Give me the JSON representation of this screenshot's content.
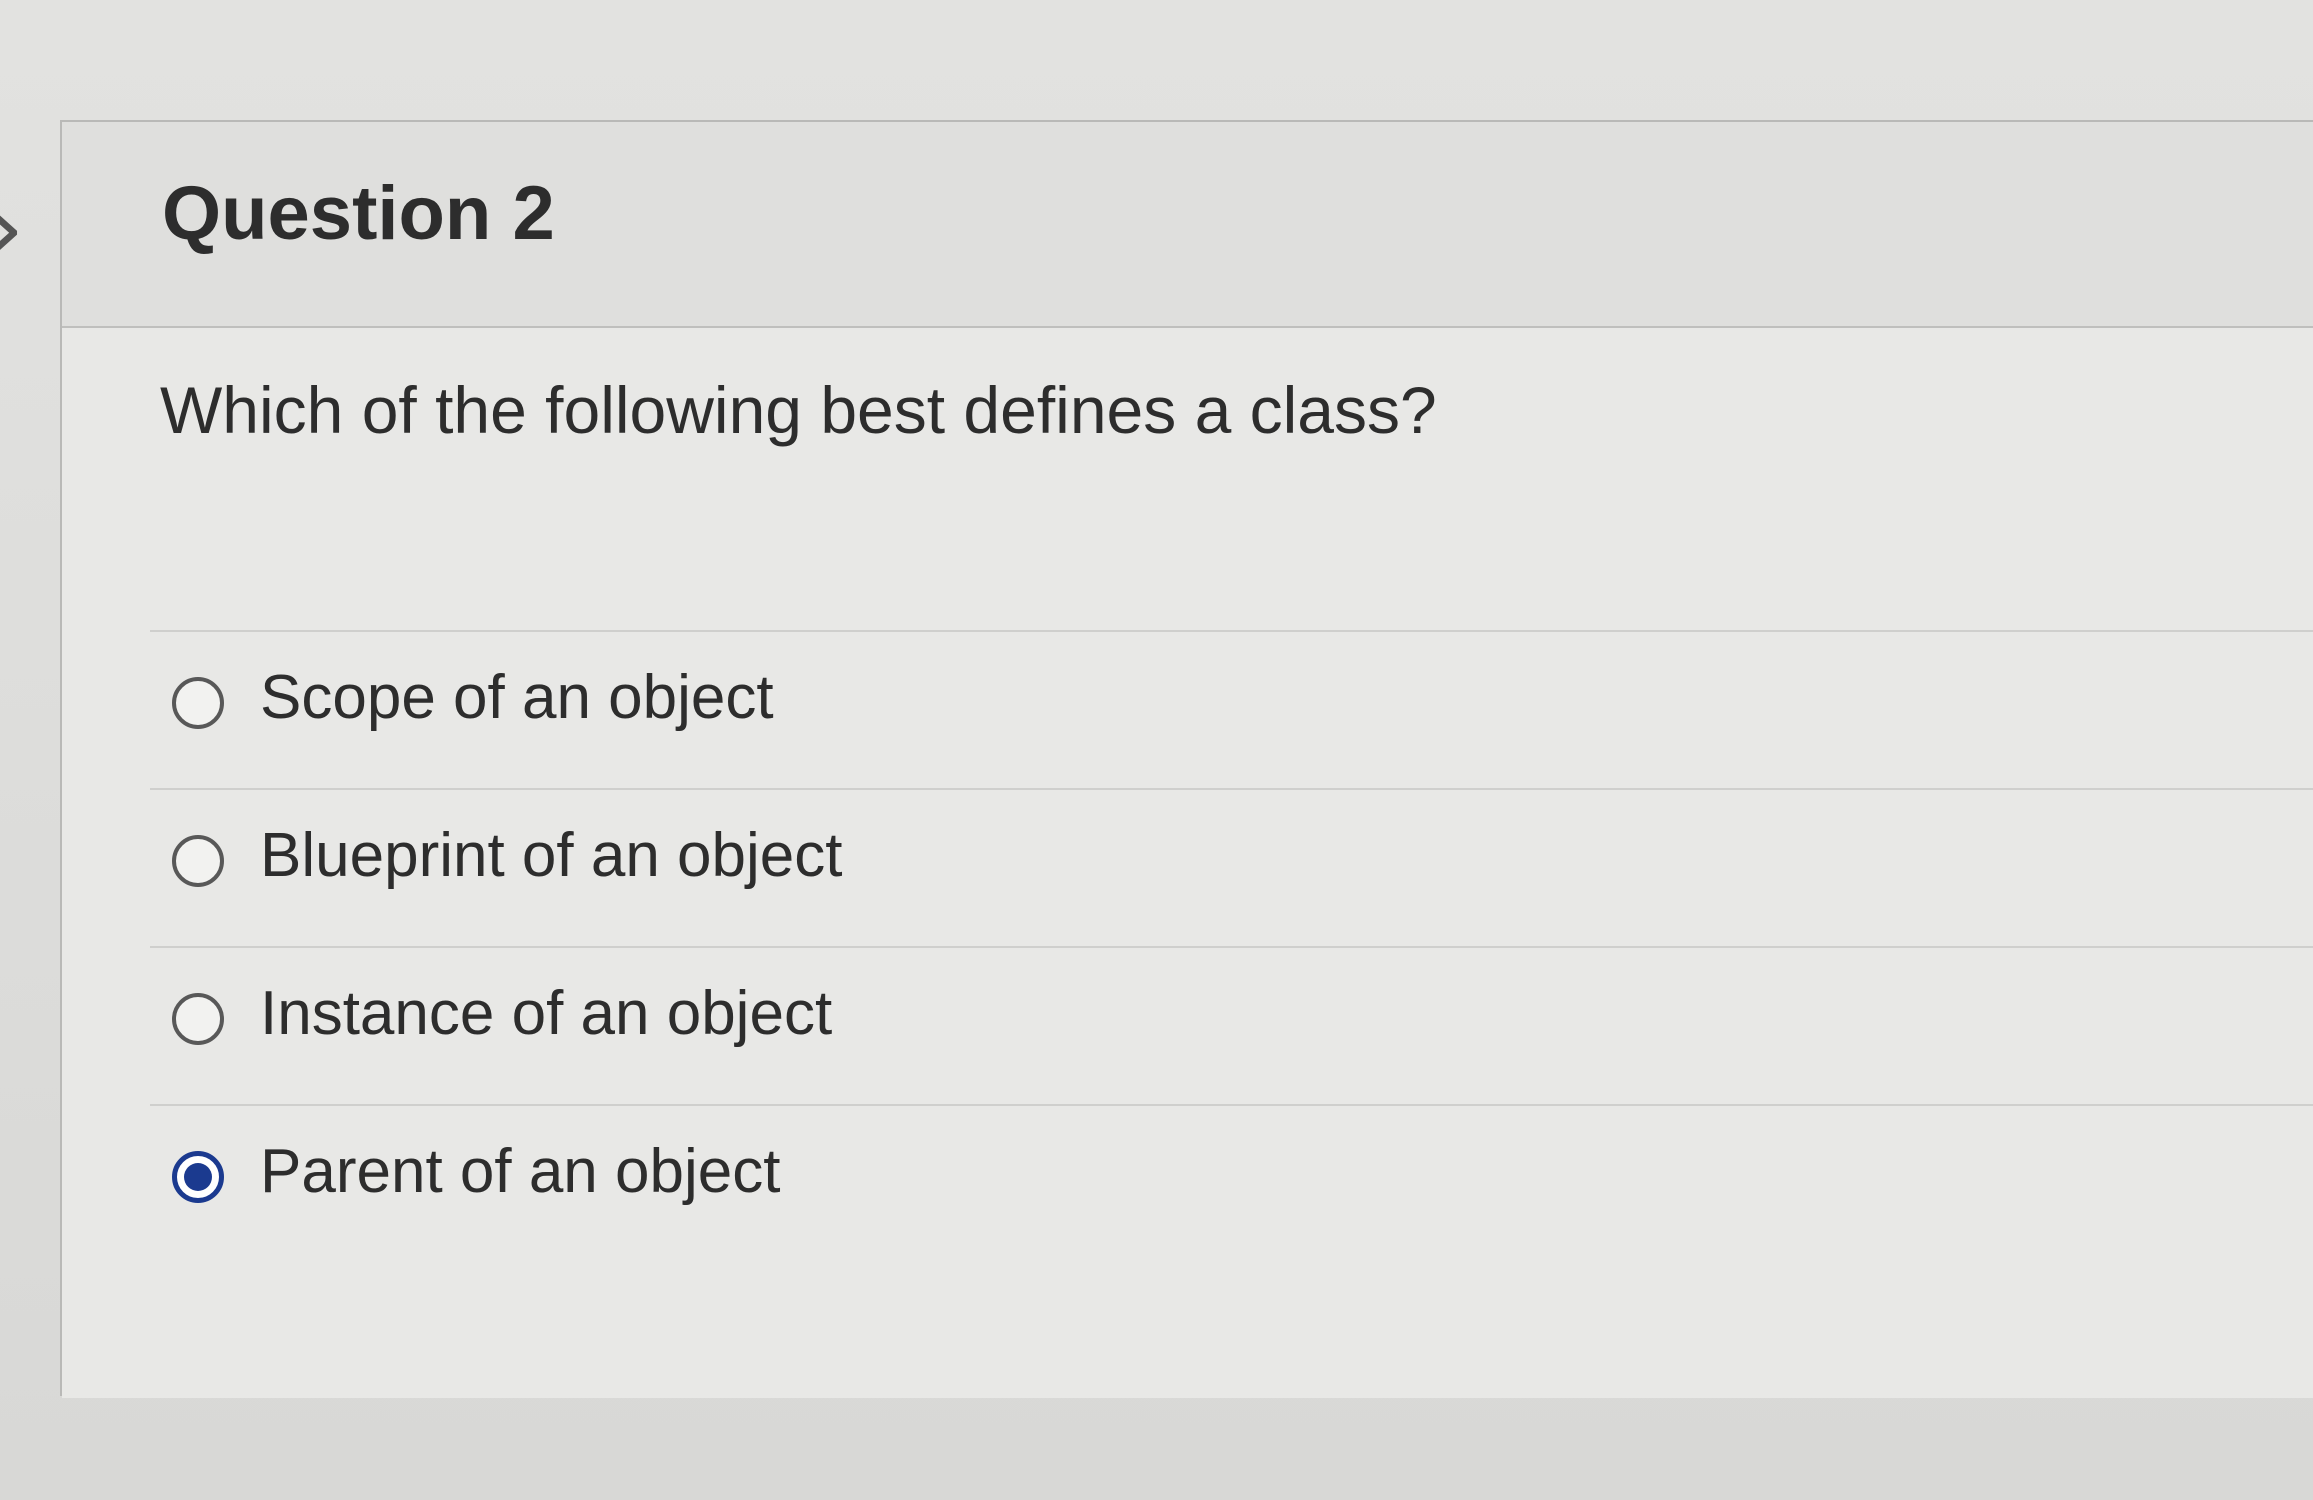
{
  "question": {
    "title": "Question 2",
    "prompt": "Which of the following best defines a class?",
    "options": [
      {
        "label": "Scope of an object",
        "selected": false
      },
      {
        "label": "Blueprint of an object",
        "selected": false
      },
      {
        "label": "Instance of an object",
        "selected": false
      },
      {
        "label": "Parent of an object",
        "selected": true
      }
    ]
  },
  "icons": {
    "expand": "chevron-right-icon"
  },
  "colors": {
    "selected_radio": "#1b3a8f",
    "text": "#2d2d2d"
  }
}
